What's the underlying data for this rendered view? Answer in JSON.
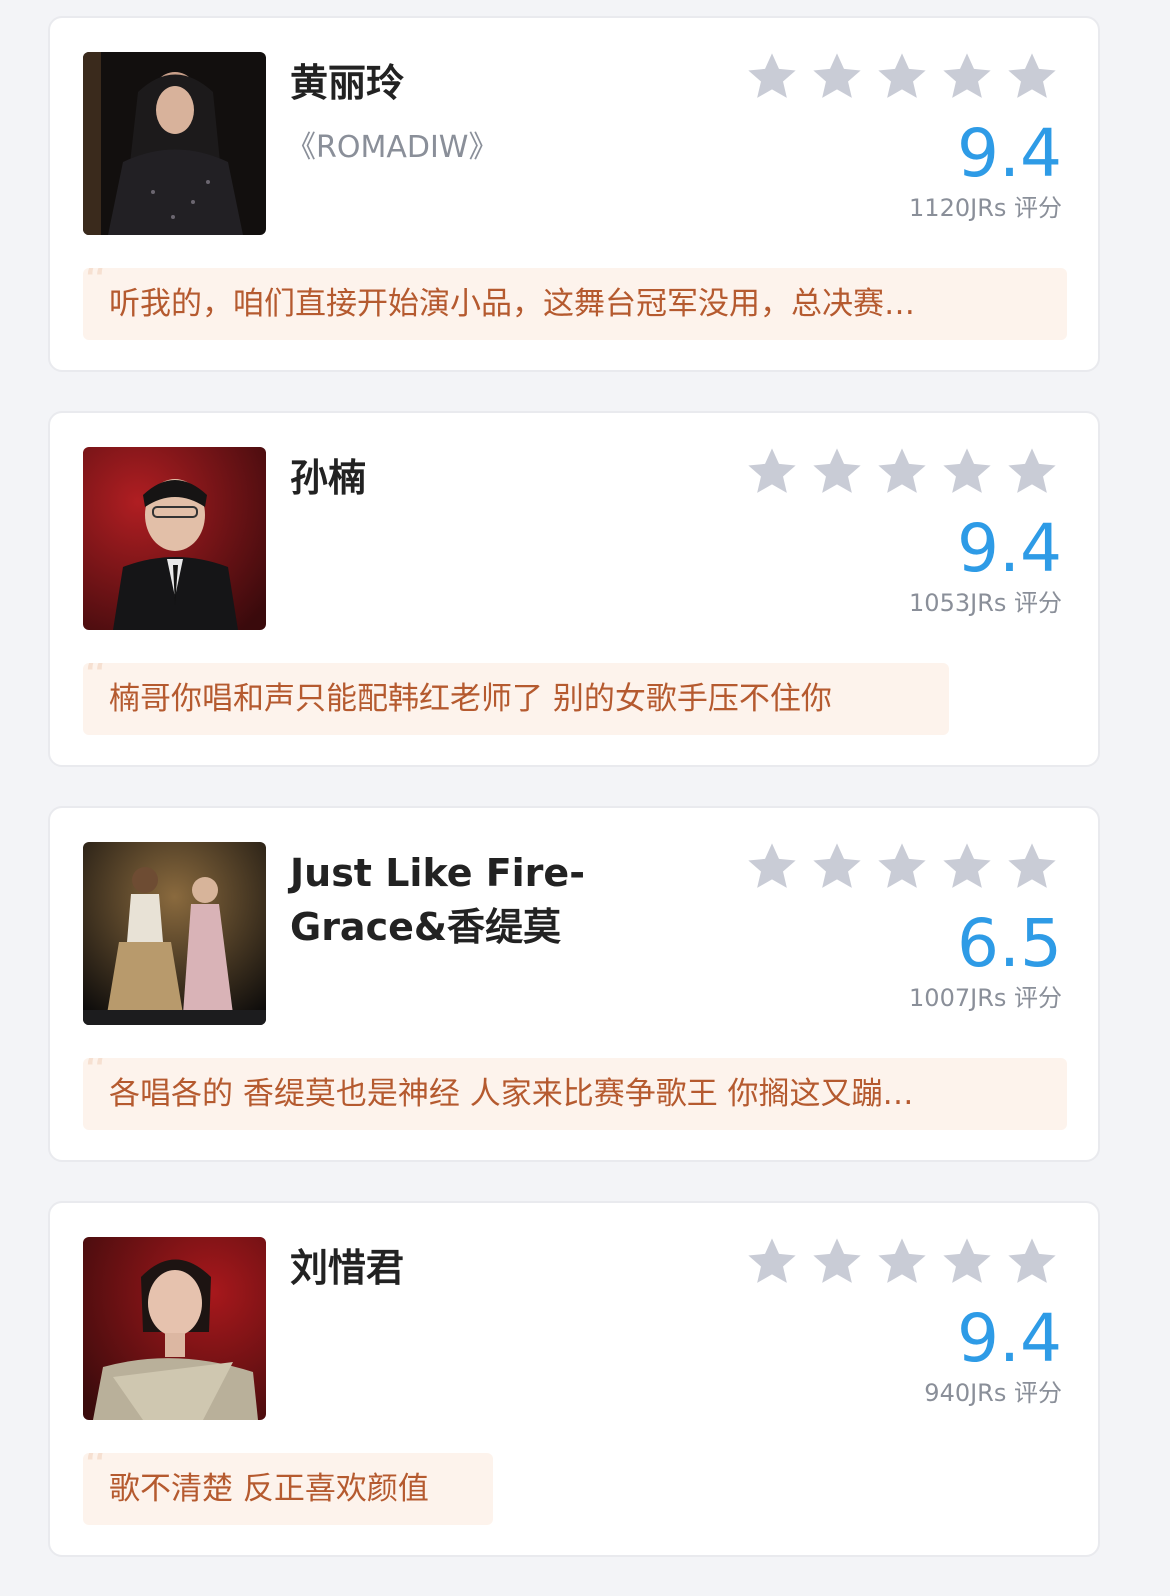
{
  "colors": {
    "score": "#2e9be6",
    "star_empty": "#c9ccd6",
    "comment_bg": "#fdf3ec",
    "comment_text": "#b55a2f"
  },
  "items": [
    {
      "title": "黄丽玲",
      "subtitle": "《ROMADIW》",
      "score": "9.4",
      "count": "1120JRs 评分",
      "stars_filled": 0,
      "comment": "听我的，咱们直接开始演小品，这舞台冠军没用，总决赛…"
    },
    {
      "title": "孙楠",
      "subtitle": "",
      "score": "9.4",
      "count": "1053JRs 评分",
      "stars_filled": 0,
      "comment": "楠哥你唱和声只能配韩红老师了 别的女歌手压不住你"
    },
    {
      "title": "Just Like Fire-Grace&香缇莫",
      "subtitle": "",
      "score": "6.5",
      "count": "1007JRs 评分",
      "stars_filled": 0,
      "comment": "各唱各的 香缇莫也是神经 人家来比赛争歌王 你搁这又蹦…"
    },
    {
      "title": "刘惜君",
      "subtitle": "",
      "score": "9.4",
      "count": "940JRs 评分",
      "stars_filled": 0,
      "comment": "歌不清楚 反正喜欢颜值"
    }
  ]
}
